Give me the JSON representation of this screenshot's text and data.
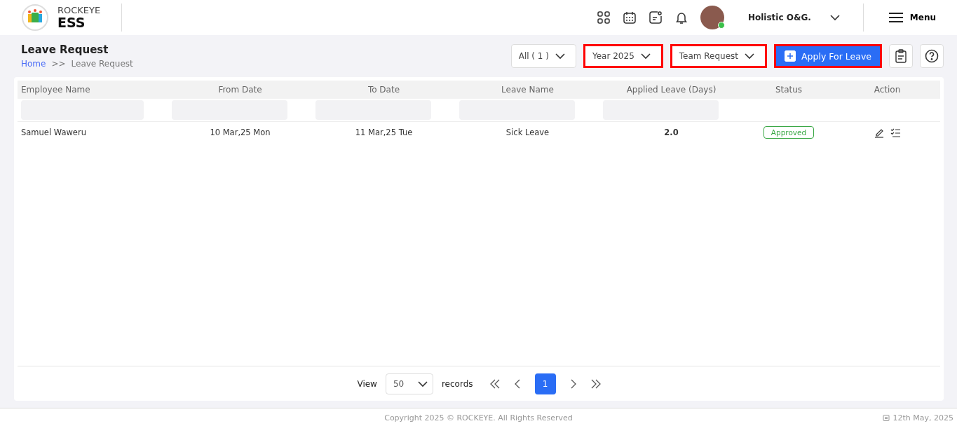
{
  "header": {
    "brand_top": "ROCKEYE",
    "brand_bottom": "ESS",
    "company": "Holistic O&G.",
    "menu_label": "Menu",
    "user_online": true
  },
  "page": {
    "title": "Leave Request",
    "breadcrumb_separator": ">>",
    "breadcrumb": [
      {
        "label": "Home",
        "kind": "link"
      },
      {
        "label": "Leave Request",
        "kind": "current"
      }
    ]
  },
  "filters": [
    {
      "label": "All ( 1 )",
      "highlighted": false
    },
    {
      "label": "Year 2025",
      "highlighted": true
    },
    {
      "label": "Team Request",
      "highlighted": true
    }
  ],
  "apply_button": {
    "label": "Apply For Leave",
    "highlighted": true
  },
  "table": {
    "columns": [
      {
        "label": "Employee Name",
        "filter": true
      },
      {
        "label": "From Date",
        "filter": true
      },
      {
        "label": "To Date",
        "filter": true
      },
      {
        "label": "Leave Name",
        "filter": true
      },
      {
        "label": "Applied Leave (Days)",
        "filter": true
      },
      {
        "label": "Status",
        "filter": false
      },
      {
        "label": "Action",
        "filter": false
      }
    ],
    "rows": [
      {
        "employee": "Samuel Waweru",
        "from": "10 Mar,25 Mon",
        "to": "11 Mar,25 Tue",
        "leave": "Sick Leave",
        "days": "2.0",
        "status": "Approved",
        "color": "#3aa845"
      }
    ]
  },
  "pagination": {
    "view_label": "View",
    "page_size": "50",
    "records_label": "records",
    "pages": [
      {
        "label": "1",
        "selected": true
      }
    ]
  },
  "footer": {
    "copyright": "Copyright 2025 © ROCKEYE. All Rights Reserved",
    "date": "12th May, 2025"
  }
}
